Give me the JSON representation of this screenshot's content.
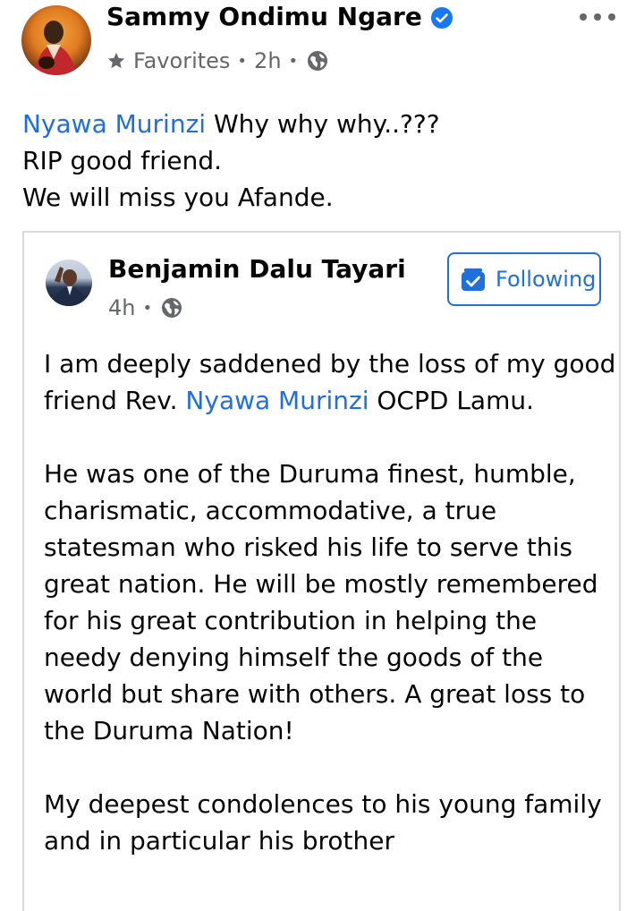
{
  "post": {
    "author": "Sammy Ondimu Ngare",
    "audience_label": "Favorites",
    "time": "2h",
    "text_mention": "Nyawa Murinzi",
    "text_line1_rest": " Why why why..???",
    "text_line2": "RIP good friend.",
    "text_line3": "We will miss you Afande."
  },
  "shared_post": {
    "author": "Benjamin Dalu Tayari",
    "time": "4h",
    "following_label": "Following",
    "p1_before": "I am deeply saddened by the loss of my good friend Rev. ",
    "p1_mention": "Nyawa Murinzi",
    "p1_after": " OCPD Lamu.",
    "p2": "He was one of the Duruma finest, humble, charismatic, accommodative, a true statesman who risked his life to serve this great nation. He will be mostly remembered for his great contribution in helping the needy denying himself the goods of the world but share with others. A great loss to the Duruma Nation!",
    "p3": "My deepest condolences to his young family and in particular his brother"
  },
  "icons": {
    "verified": "verified-badge-icon",
    "audience": "star-icon",
    "privacy": "globe-icon",
    "more": "more-options-icon",
    "following": "following-check-icon"
  },
  "colors": {
    "link": "#216fdb",
    "verified": "#1877f2",
    "meta": "#65676b"
  }
}
